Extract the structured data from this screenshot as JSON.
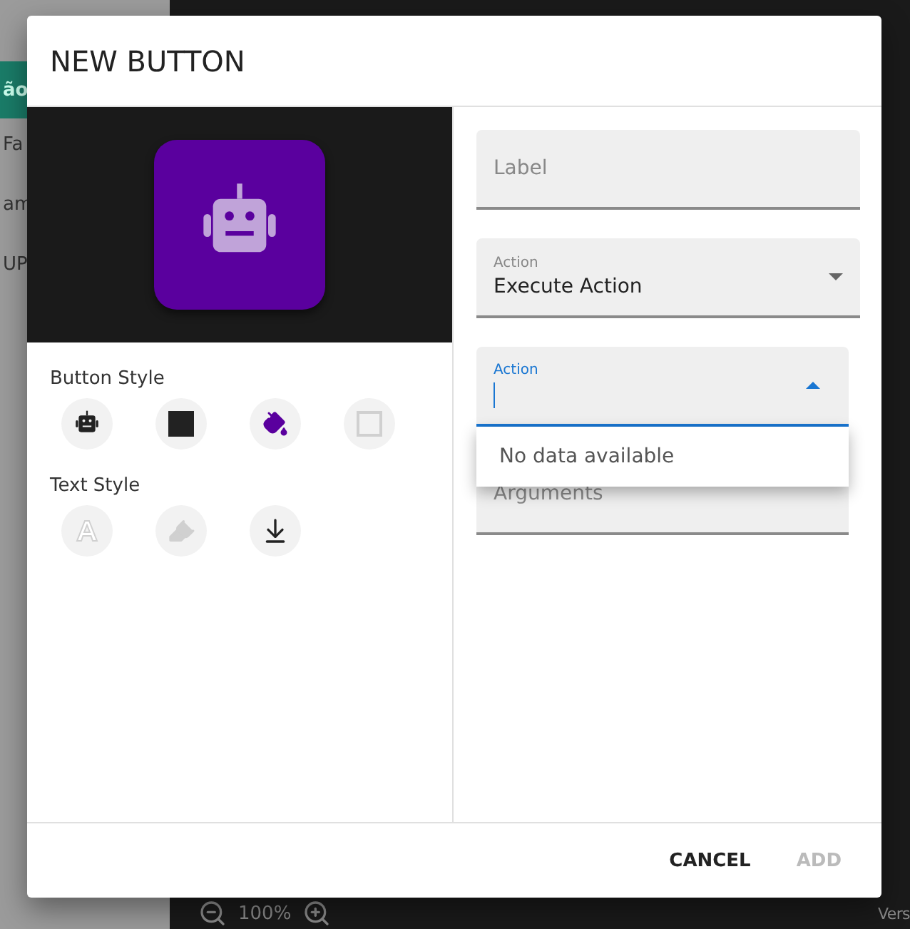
{
  "background": {
    "sidebar_items": [
      {
        "label": "ão",
        "selected": true
      },
      {
        "label": "Fa",
        "selected": false
      },
      {
        "label": "am",
        "selected": false
      },
      {
        "label": "UP",
        "selected": false
      }
    ],
    "zoom": "100%",
    "version": "Vers"
  },
  "dialog": {
    "title": "NEW BUTTON",
    "button_style": {
      "label": "Button Style",
      "options": [
        {
          "kind": "robot",
          "disabled": false
        },
        {
          "kind": "solid",
          "disabled": false
        },
        {
          "kind": "fill",
          "disabled": false
        },
        {
          "kind": "outline",
          "disabled": true
        }
      ]
    },
    "text_style": {
      "label": "Text Style",
      "options": [
        {
          "kind": "letter",
          "disabled": true
        },
        {
          "kind": "marker",
          "disabled": true
        },
        {
          "kind": "align",
          "disabled": false
        }
      ]
    },
    "fields": [
      {
        "kind": "text",
        "placeholder": "Label",
        "focused": false
      },
      {
        "kind": "select",
        "label": "Action",
        "value": "Execute Action",
        "focused": false
      },
      {
        "kind": "autocomplete",
        "label": "Action",
        "focused": true
      },
      {
        "kind": "text",
        "placeholder": "Arguments",
        "focused": false
      }
    ],
    "menu": {
      "items": [
        "No data available"
      ]
    },
    "buttons": [
      {
        "label": "CANCEL",
        "disabled": false
      },
      {
        "label": "ADD",
        "disabled": true
      }
    ]
  }
}
